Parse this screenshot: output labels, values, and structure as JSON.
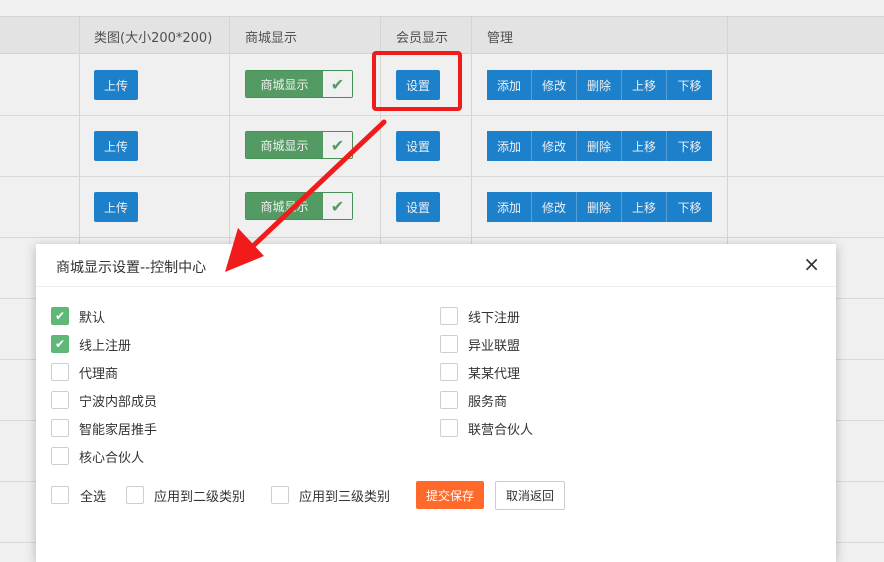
{
  "table": {
    "headers": [
      "类图(大小200*200)",
      "商城显示",
      "会员显示",
      "管理"
    ],
    "rows": [
      {
        "upload": "上传",
        "mall_show": "商城显示",
        "member_set": "设置",
        "actions": [
          "添加",
          "修改",
          "删除",
          "上移",
          "下移"
        ]
      },
      {
        "upload": "上传",
        "mall_show": "商城显示",
        "member_set": "设置",
        "actions": [
          "添加",
          "修改",
          "删除",
          "上移",
          "下移"
        ]
      },
      {
        "upload": "上传",
        "mall_show": "商城显示",
        "member_set": "设置",
        "actions": [
          "添加",
          "修改",
          "删除",
          "上移",
          "下移"
        ]
      }
    ]
  },
  "modal": {
    "title": "商城显示设置--控制中心",
    "close_icon": "×",
    "options_left": [
      {
        "label": "默认",
        "checked": true
      },
      {
        "label": "线上注册",
        "checked": true
      },
      {
        "label": "代理商",
        "checked": false
      },
      {
        "label": "宁波内部成员",
        "checked": false
      },
      {
        "label": "智能家居推手",
        "checked": false
      },
      {
        "label": "核心合伙人",
        "checked": false
      }
    ],
    "options_right": [
      {
        "label": "线下注册",
        "checked": false
      },
      {
        "label": "异业联盟",
        "checked": false
      },
      {
        "label": "某某代理",
        "checked": false
      },
      {
        "label": "服务商",
        "checked": false
      },
      {
        "label": "联营合伙人",
        "checked": false
      }
    ],
    "footer": {
      "select_all": "全选",
      "apply_level2": "应用到二级类别",
      "apply_level3": "应用到三级类别",
      "submit": "提交保存",
      "cancel": "取消返回"
    }
  },
  "colors": {
    "primary_blue": "#1e88d8",
    "success_green": "#5fb878",
    "submit_orange": "#ff6a2b",
    "highlight_red": "#f21b1b"
  }
}
